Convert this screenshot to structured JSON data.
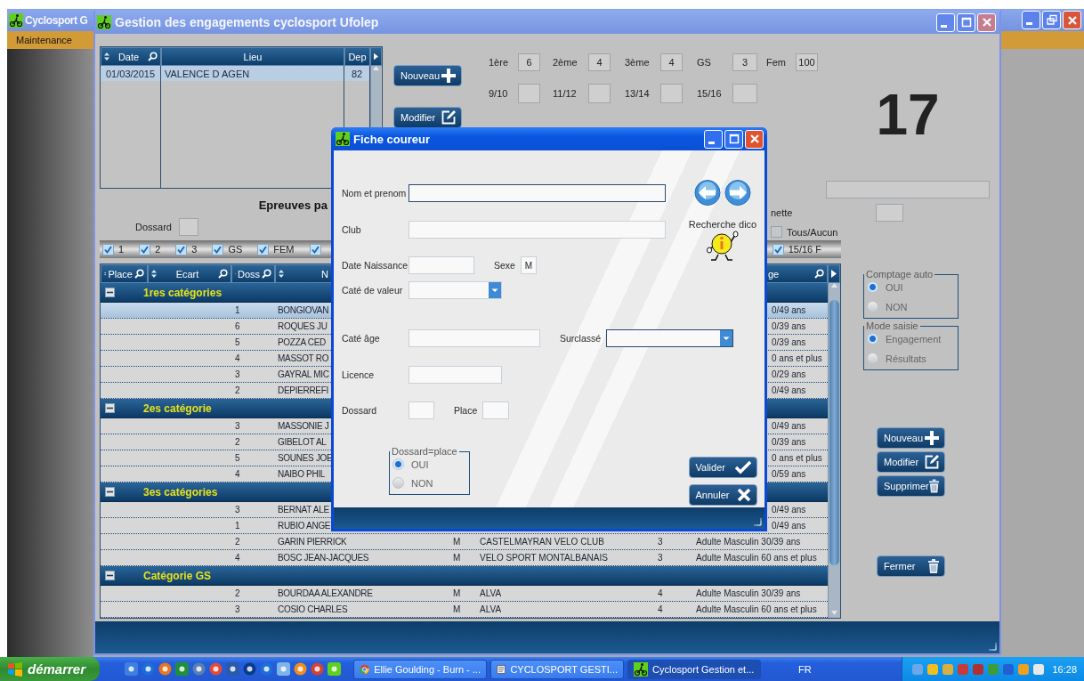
{
  "outer_window": {
    "title": "Cyclosport G",
    "menu": [
      {
        "label": "Maintenance"
      }
    ]
  },
  "main_window": {
    "title": "Gestion des engagements cyclosport Ufolep"
  },
  "events_table": {
    "columns": [
      "Date",
      "Lieu",
      "Dep"
    ],
    "rows": [
      {
        "cells": [
          "01/03/2015",
          "VALENCE D AGEN",
          "82"
        ],
        "selected": true
      }
    ]
  },
  "event_buttons": [
    {
      "label": "Nouveau",
      "kind": "add"
    },
    {
      "label": "Modifier",
      "kind": "edit"
    }
  ],
  "counters": [
    {
      "label": "1ère",
      "value": "6"
    },
    {
      "label": "2ème",
      "value": "4"
    },
    {
      "label": "3ème",
      "value": "4"
    },
    {
      "label": "GS",
      "value": "3"
    },
    {
      "label": "Fem",
      "value": "100"
    },
    {
      "label": "9/10"
    },
    {
      "label": "11/12"
    },
    {
      "label": "13/14"
    },
    {
      "label": "15/16"
    }
  ],
  "total": "17",
  "section_title": "Epreuves pa",
  "dossard_label": "Dossard",
  "side_label": "nette",
  "all_toggle": {
    "label": "Tous/Aucun",
    "checked": false
  },
  "filters": [
    {
      "label": "1",
      "checked": true
    },
    {
      "label": "2",
      "checked": true
    },
    {
      "label": "3",
      "checked": true
    },
    {
      "label": "GS",
      "checked": true
    },
    {
      "label": "FEM",
      "checked": true
    },
    {
      "checked": true
    },
    {
      "label": "15/16 F",
      "checked": true
    }
  ],
  "results": {
    "columns": [
      {
        "label": "Place"
      },
      {
        "label": "Ecart"
      },
      {
        "label": "Doss"
      },
      {
        "label": "N"
      },
      {
        "label": "ge"
      }
    ],
    "groups": [
      {
        "title": "1res catégories",
        "expanded": true,
        "rows": [
          {
            "doss": "1",
            "name": "BONGIOVAN",
            "age": "0/49 ans",
            "selected": true
          },
          {
            "doss": "6",
            "name": "ROQUES JU",
            "age": "0/39 ans",
            "selected": false
          },
          {
            "doss": "5",
            "name": "POZZA CED",
            "age": "0/39 ans",
            "selected": false
          },
          {
            "doss": "4",
            "name": "MASSOT RO",
            "age": "0 ans et plus",
            "selected": false
          },
          {
            "doss": "3",
            "name": "GAYRAL MIC",
            "age": "0/29 ans",
            "selected": false
          },
          {
            "doss": "2",
            "name": "DEPIERREFI",
            "age": "0/49 ans",
            "selected": false
          }
        ]
      },
      {
        "title": "2es catégorie",
        "expanded": true,
        "rows": [
          {
            "doss": "3",
            "name": "MASSONIE J",
            "age": "0/49 ans",
            "selected": false
          },
          {
            "doss": "2",
            "name": "GIBELOT AL",
            "age": "0/39 ans",
            "selected": false
          },
          {
            "doss": "5",
            "name": "SOUNES JOE",
            "age": "0 ans et plus",
            "selected": false
          },
          {
            "doss": "4",
            "name": "NAIBO PHIL",
            "age": "0/59 ans",
            "selected": false
          }
        ]
      },
      {
        "title": "3es catégories",
        "expanded": true,
        "rows": [
          {
            "doss": "3",
            "name": "BERNAT ALE",
            "age": "0/49 ans",
            "selected": false
          },
          {
            "doss": "1",
            "name": "RUBIO ANGE",
            "age": "0/49 ans",
            "selected": false
          },
          {
            "doss": "2",
            "name": "GARIN PIERRICK",
            "sex": "M",
            "club": "CASTELMAYRAN VELO CLUB",
            "cat": "3",
            "age": "Adulte Masculin 30/39 ans",
            "selected": false
          },
          {
            "doss": "4",
            "name": "BOSC JEAN-JACQUES",
            "sex": "M",
            "club": "VELO SPORT MONTALBANAIS",
            "cat": "3",
            "age": "Adulte Masculin 60 ans et plus",
            "selected": false
          }
        ]
      },
      {
        "title": "Catégorie GS",
        "expanded": true,
        "rows": [
          {
            "doss": "2",
            "name": "BOURDAA ALEXANDRE",
            "sex": "M",
            "club": "ALVA",
            "cat": "4",
            "age": "Adulte Masculin 30/39 ans",
            "selected": false
          },
          {
            "doss": "3",
            "name": "COSIO CHARLES",
            "sex": "M",
            "club": "ALVA",
            "cat": "4",
            "age": "Adulte Masculin 60 ans et plus",
            "selected": false
          }
        ]
      }
    ]
  },
  "option_groups": [
    {
      "title": "Comptage auto",
      "options": [
        {
          "label": "OUI",
          "selected": true
        },
        {
          "label": "NON",
          "selected": false
        }
      ]
    },
    {
      "title": "Mode saisie",
      "options": [
        {
          "label": "Engagement",
          "selected": true
        },
        {
          "label": "Résultats",
          "selected": false
        }
      ]
    }
  ],
  "actions": [
    {
      "label": "Nouveau",
      "kind": "add"
    },
    {
      "label": "Modifier",
      "kind": "edit"
    },
    {
      "label": "Supprimer",
      "kind": "delete"
    }
  ],
  "close_button": {
    "label": "Fermer",
    "kind": "delete"
  },
  "dialog": {
    "title": "Fiche coureur",
    "rows": [
      [
        {
          "label": "Nom et prenom",
          "kind": "text",
          "outlined": true
        }
      ],
      [
        {
          "label": "Club",
          "kind": "text",
          "outlined": false
        }
      ],
      [
        {
          "label": "Date Naissance",
          "kind": "text",
          "outlined": false
        },
        {
          "label": "Sexe",
          "kind": "text",
          "value": "M",
          "outlined": false
        }
      ],
      [
        {
          "label": "Caté de valeur",
          "kind": "combo",
          "outlined": false
        }
      ],
      [
        {
          "label": "Caté âge",
          "kind": "text",
          "outlined": false
        },
        {
          "label": "Surclassé",
          "kind": "combo",
          "outlined": true
        }
      ],
      [
        {
          "label": "Licence",
          "kind": "text",
          "outlined": false
        }
      ],
      [
        {
          "label": "Dossard",
          "kind": "text",
          "outlined": false
        },
        {
          "label": "Place",
          "kind": "text",
          "outlined": false
        }
      ]
    ],
    "search_label": "Recherche dico",
    "option_group": {
      "title": "Dossard=place",
      "options": [
        {
          "label": "OUI",
          "selected": true
        },
        {
          "label": "NON",
          "selected": false
        }
      ]
    },
    "buttons": [
      {
        "label": "Valider",
        "kind": "validate"
      },
      {
        "label": "Annuler",
        "kind": "cancel"
      }
    ]
  },
  "taskbar": {
    "start": "démarrer",
    "tasks": [
      {
        "label": "Ellie Goulding - Burn - ...",
        "kind": "browser",
        "selected": false
      },
      {
        "label": "CYCLOSPORT GESTI...",
        "kind": "document",
        "selected": false
      },
      {
        "label": "Cyclosport Gestion et...",
        "kind": "app",
        "selected": true
      }
    ],
    "language": "FR",
    "clock": "16:28"
  }
}
